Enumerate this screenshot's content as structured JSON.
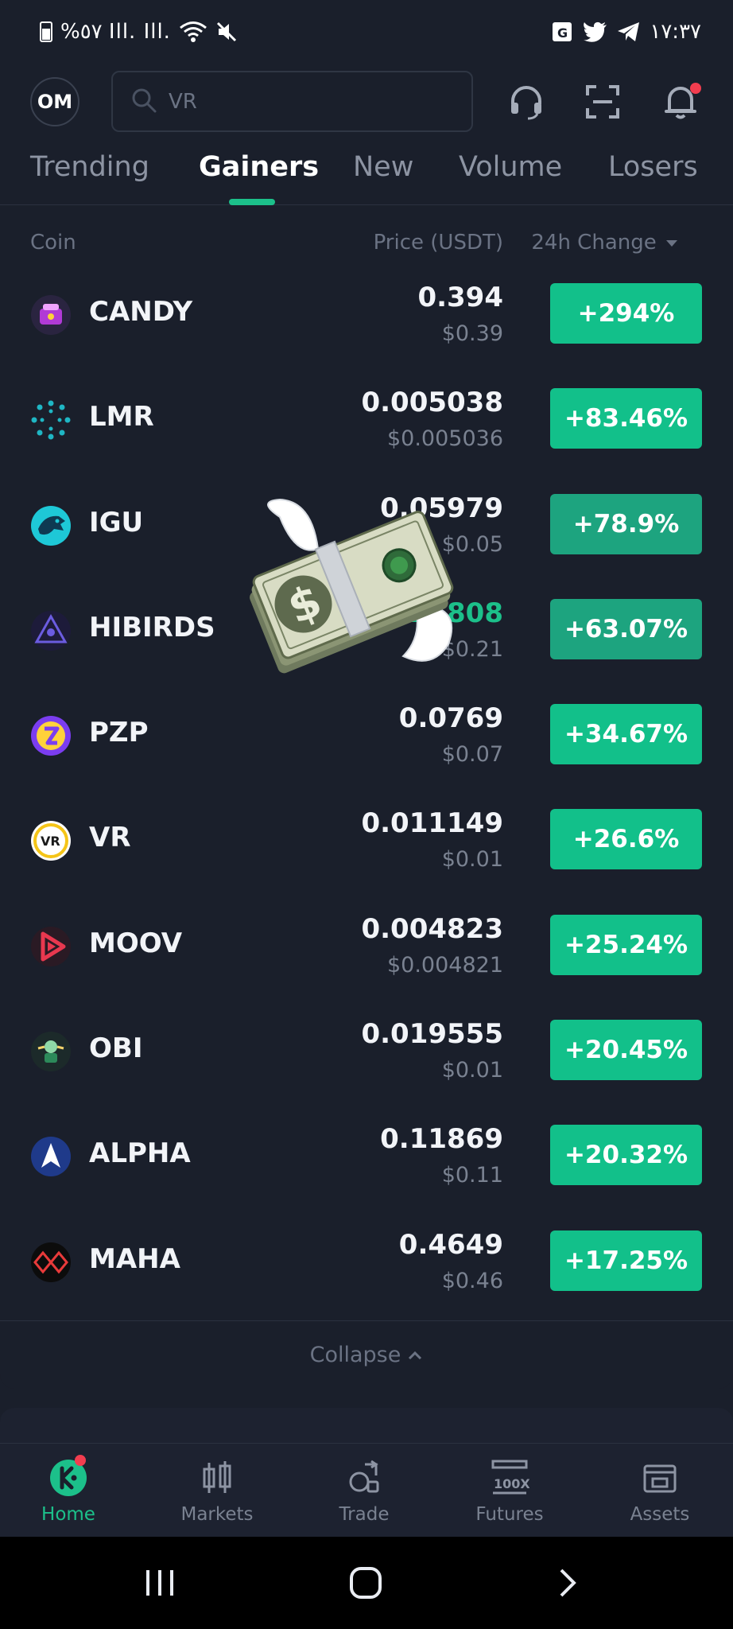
{
  "status_bar": {
    "left_text": "%٥٧ Ill. Ill.",
    "time": "١٧:٣٧"
  },
  "header": {
    "avatar_initials": "OM",
    "search_placeholder": "VR"
  },
  "tabs": [
    {
      "label": "Trending",
      "active": false
    },
    {
      "label": "Gainers",
      "active": true
    },
    {
      "label": "New",
      "active": false
    },
    {
      "label": "Volume",
      "active": false
    },
    {
      "label": "Losers",
      "active": false
    }
  ],
  "columns": {
    "coin": "Coin",
    "price": "Price (USDT)",
    "change": "24h Change"
  },
  "rows": [
    {
      "coin": "CANDY",
      "price": "0.394",
      "usd": "$0.39",
      "change": "+294%",
      "logo_color": "#b13ad6"
    },
    {
      "coin": "LMR",
      "price": "0.005038",
      "usd": "$0.005036",
      "change": "+83.46%",
      "logo_color": "#1fb6c4"
    },
    {
      "coin": "IGU",
      "price": "0.05979",
      "usd": "$0.05",
      "change": "+78.9%",
      "logo_color": "#1ec8d7"
    },
    {
      "coin": "HIBIRDS",
      "price": "0.21808",
      "usd": "$0.21",
      "change": "+63.07%",
      "logo_color": "#3b3a8f"
    },
    {
      "coin": "PZP",
      "price": "0.0769",
      "usd": "$0.07",
      "change": "+34.67%",
      "logo_color": "#7b3df0"
    },
    {
      "coin": "VR",
      "price": "0.011149",
      "usd": "$0.01",
      "change": "+26.6%",
      "logo_color": "#f5c518"
    },
    {
      "coin": "MOOV",
      "price": "0.004823",
      "usd": "$0.004821",
      "change": "+25.24%",
      "logo_color": "#e8384f"
    },
    {
      "coin": "OBI",
      "price": "0.019555",
      "usd": "$0.01",
      "change": "+20.45%",
      "logo_color": "#2c8a5a"
    },
    {
      "coin": "ALPHA",
      "price": "0.11869",
      "usd": "$0.11",
      "change": "+20.32%",
      "logo_color": "#2a6ae8"
    },
    {
      "coin": "MAHA",
      "price": "0.4649",
      "usd": "$0.46",
      "change": "+17.25%",
      "logo_color": "#e83a3a"
    }
  ],
  "collapse_label": "Collapse",
  "bottom_nav": [
    {
      "label": "Home",
      "active": true
    },
    {
      "label": "Markets",
      "active": false
    },
    {
      "label": "Trade",
      "active": false
    },
    {
      "label": "Futures",
      "active": false
    },
    {
      "label": "Assets",
      "active": false
    }
  ],
  "colors": {
    "accent": "#1cc08a",
    "badge_red": "#f23d4f",
    "background": "#1a1f2b"
  }
}
